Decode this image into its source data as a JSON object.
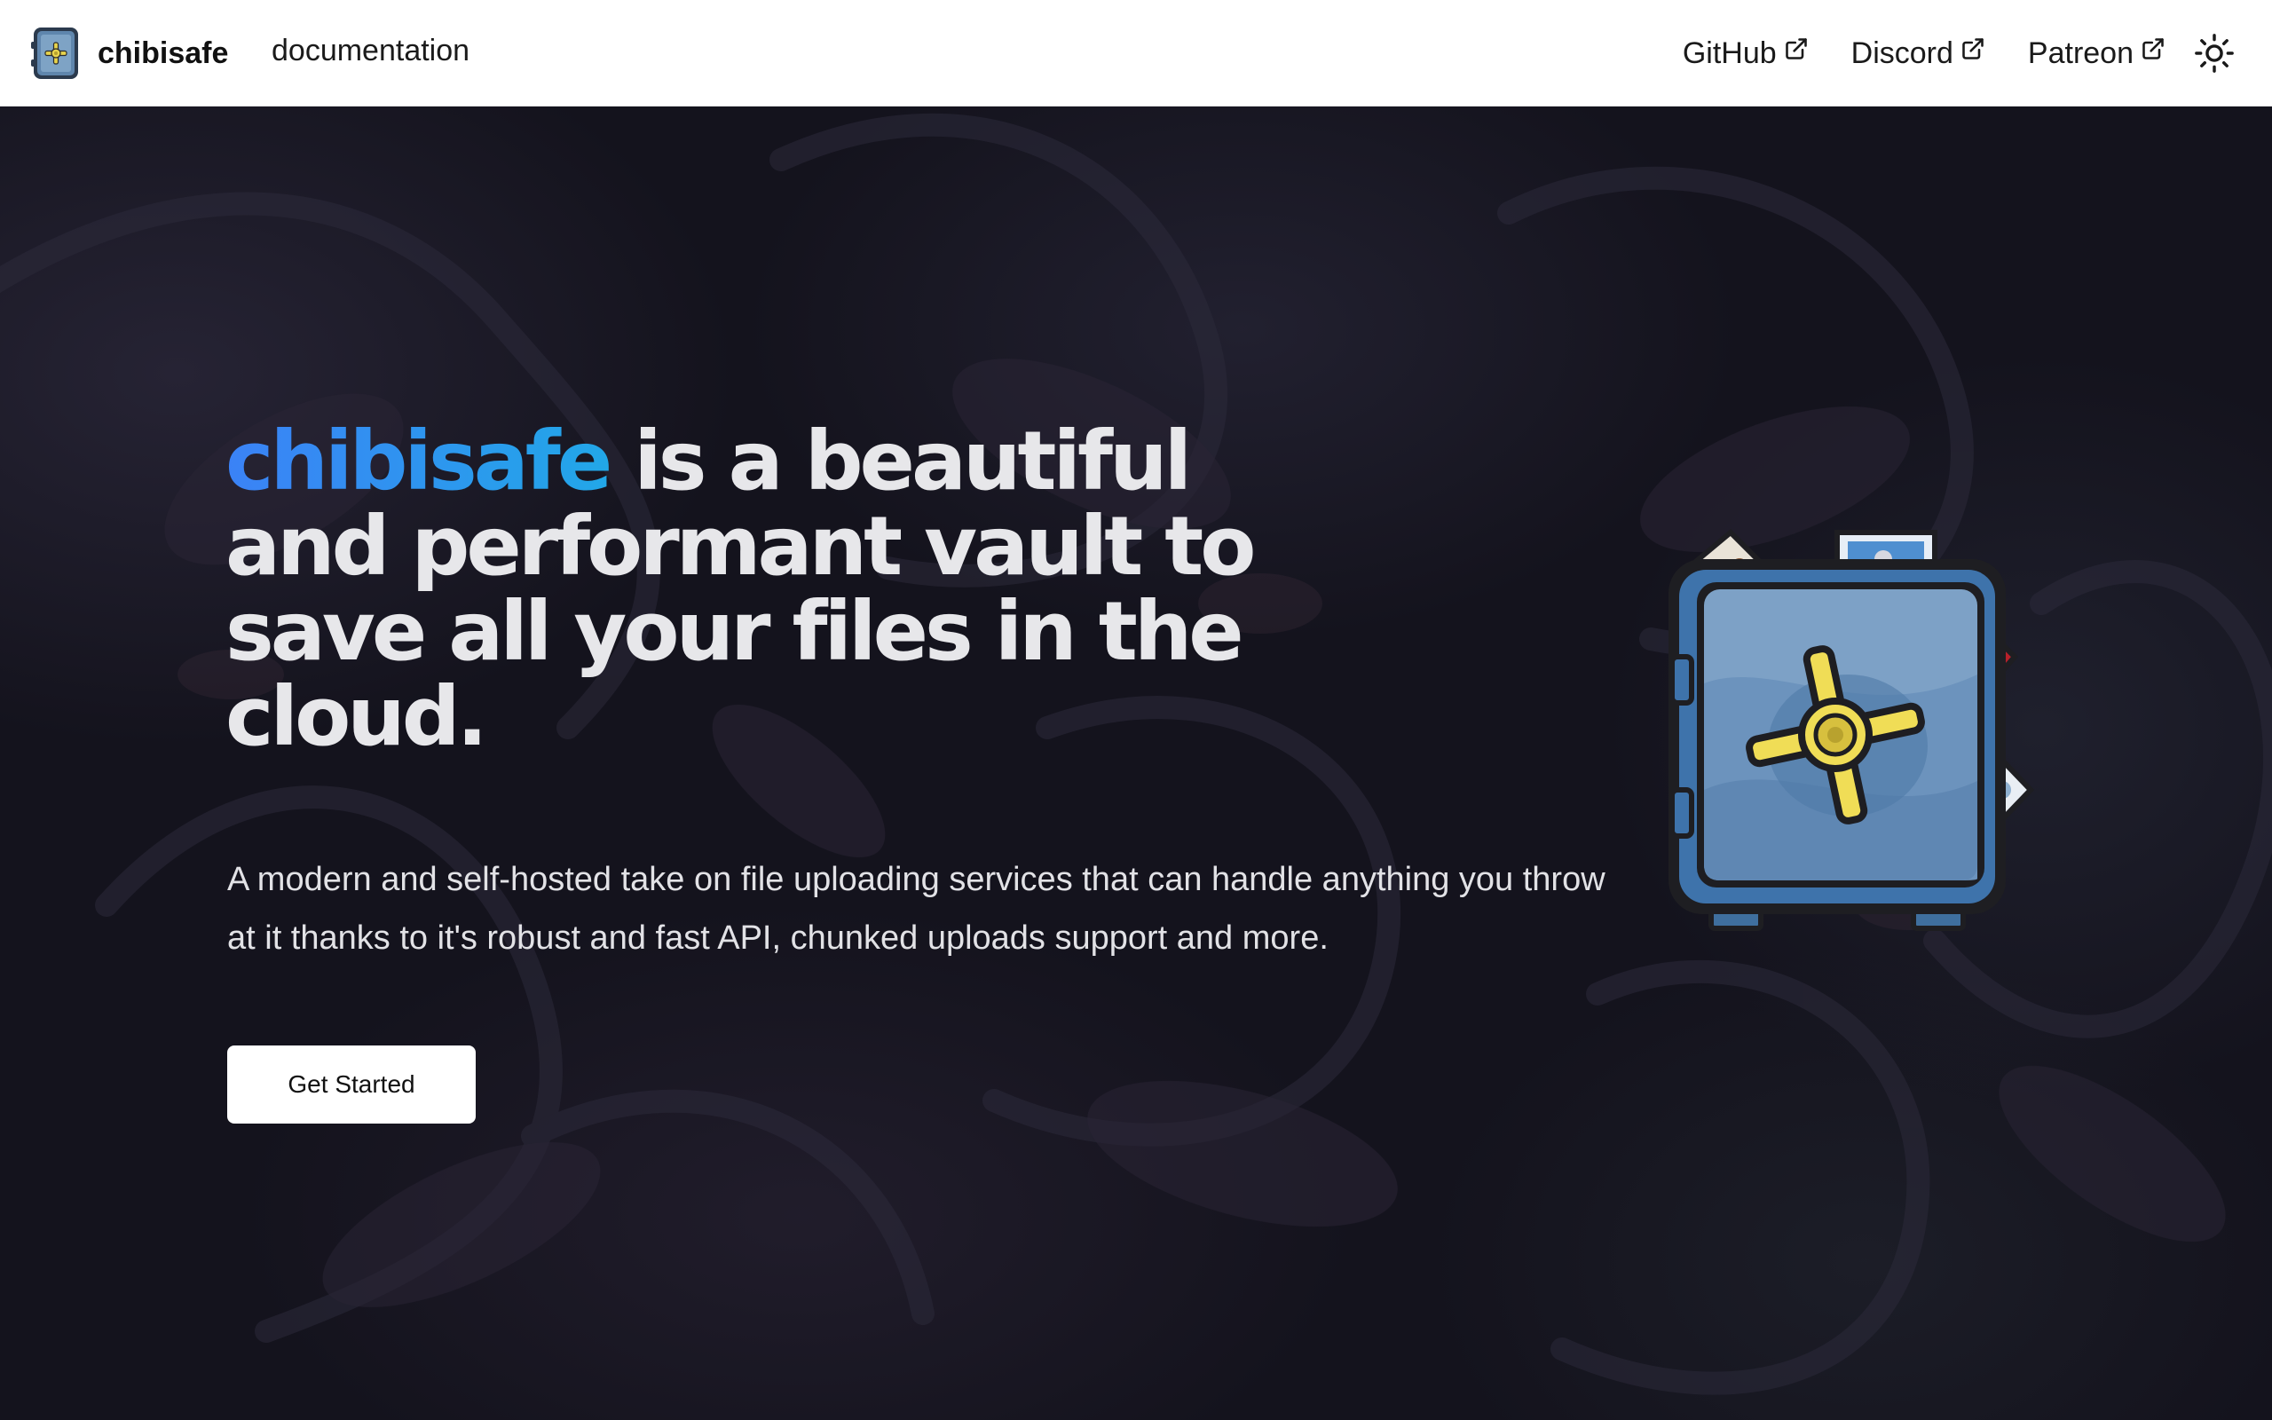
{
  "header": {
    "brand_name": "chibisafe",
    "nav": {
      "documentation": "documentation"
    },
    "external_links": [
      {
        "label": "GitHub"
      },
      {
        "label": "Discord"
      },
      {
        "label": "Patreon"
      }
    ],
    "theme_toggle_icon": "sun-icon"
  },
  "hero": {
    "headline_accent": "chibisafe",
    "headline_line1_rest": " is a beautiful",
    "headline_line2": "and performant vault to",
    "headline_line3": "save all your files in the cloud.",
    "description": "A modern and self-hosted take on file uploading services that can handle anything you throw at it thanks to it's robust and fast API, chunked uploads support and more.",
    "cta_label": "Get Started",
    "illustration_icon": "vault-icon"
  },
  "colors": {
    "header_bg": "#ffffff",
    "hero_bg": "#14131d",
    "accent_start": "#3b82f6",
    "accent_end": "#22a7e8",
    "headline_text": "#e7e7ea",
    "cta_bg": "#ffffff"
  }
}
